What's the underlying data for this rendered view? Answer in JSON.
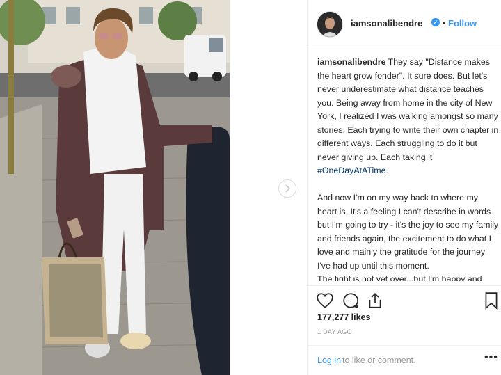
{
  "post": {
    "username": "iamsonalibendre",
    "separator": "•",
    "follow_label": "Follow",
    "caption": {
      "username": "iamsonalibendre",
      "para1": "They say \"Distance makes the heart grow fonder\". It sure does. But let's never underestimate what distance teaches you. Being away from home in the city of New York, I realized I was walking amongst so many stories. Each trying to write their own chapter in different ways. Each struggling to do it but never giving up. Each taking it ",
      "hashtag": "#OneDayAtATime",
      "para1_end": ".",
      "para2": "And now I'm on my way back to where my heart is. It's a feeling I can't describe in words but I'm going to try - it's the joy to see my family and friends again, the excitement to do what I love and mainly the gratitude for the journey I've had up until this moment.",
      "para3": "The fight is not yet over...but I'm happy and looking forward to this happy interval :) It's time to learn that there is a new normal out"
    },
    "likes": "177,277 likes",
    "time_ago": "1 DAY AGO",
    "login_link": "Log in",
    "login_rest": "to like or comment.",
    "more": "•••"
  },
  "icons": {
    "verified": "verified-badge-icon",
    "like": "heart-icon",
    "comment": "comment-icon",
    "share": "share-icon",
    "save": "bookmark-icon",
    "next": "chevron-right-icon"
  },
  "colors": {
    "link": "#3897f0",
    "text": "#262626",
    "muted": "#999999",
    "border": "#efefef"
  }
}
